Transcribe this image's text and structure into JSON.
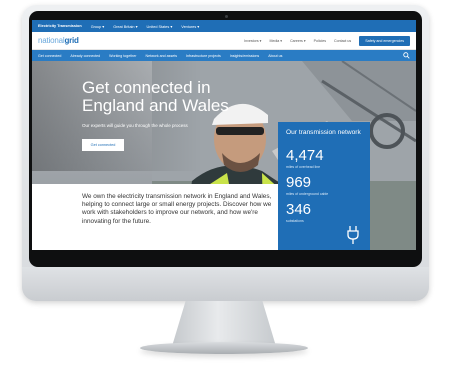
{
  "topbar": {
    "items": [
      "Electricity Transmission",
      "Group ▾",
      "Great Britain ▾",
      "United States ▾",
      "Ventures ▾"
    ]
  },
  "header": {
    "logo_part1": "national",
    "logo_part2": "grid",
    "utility_links": [
      "Investors ▾",
      "Media ▾",
      "Careers ▾",
      "Policies",
      "Contact us"
    ],
    "cta": "Safety and emergencies"
  },
  "nav": {
    "items": [
      "Get connected",
      "Already connected",
      "Working together",
      "Network and assets",
      "Infrastructure projects",
      "Insights/emissions",
      "About us"
    ]
  },
  "hero": {
    "headline": "Get connected in England and Wales",
    "subline": "Our experts will guide you through the whole process",
    "button": "Get connected"
  },
  "intro": {
    "text": "We own the electricity transmission network in England and Wales, helping to connect large or small energy projects. Discover how we work with stakeholders to improve our network, and how we're innovating for the future."
  },
  "stats": {
    "title": "Our transmission network",
    "items": [
      {
        "value": "4,474",
        "caption": "miles of overhead line"
      },
      {
        "value": "969",
        "caption": "miles of underground cable"
      },
      {
        "value": "346",
        "caption": "substations"
      }
    ]
  }
}
